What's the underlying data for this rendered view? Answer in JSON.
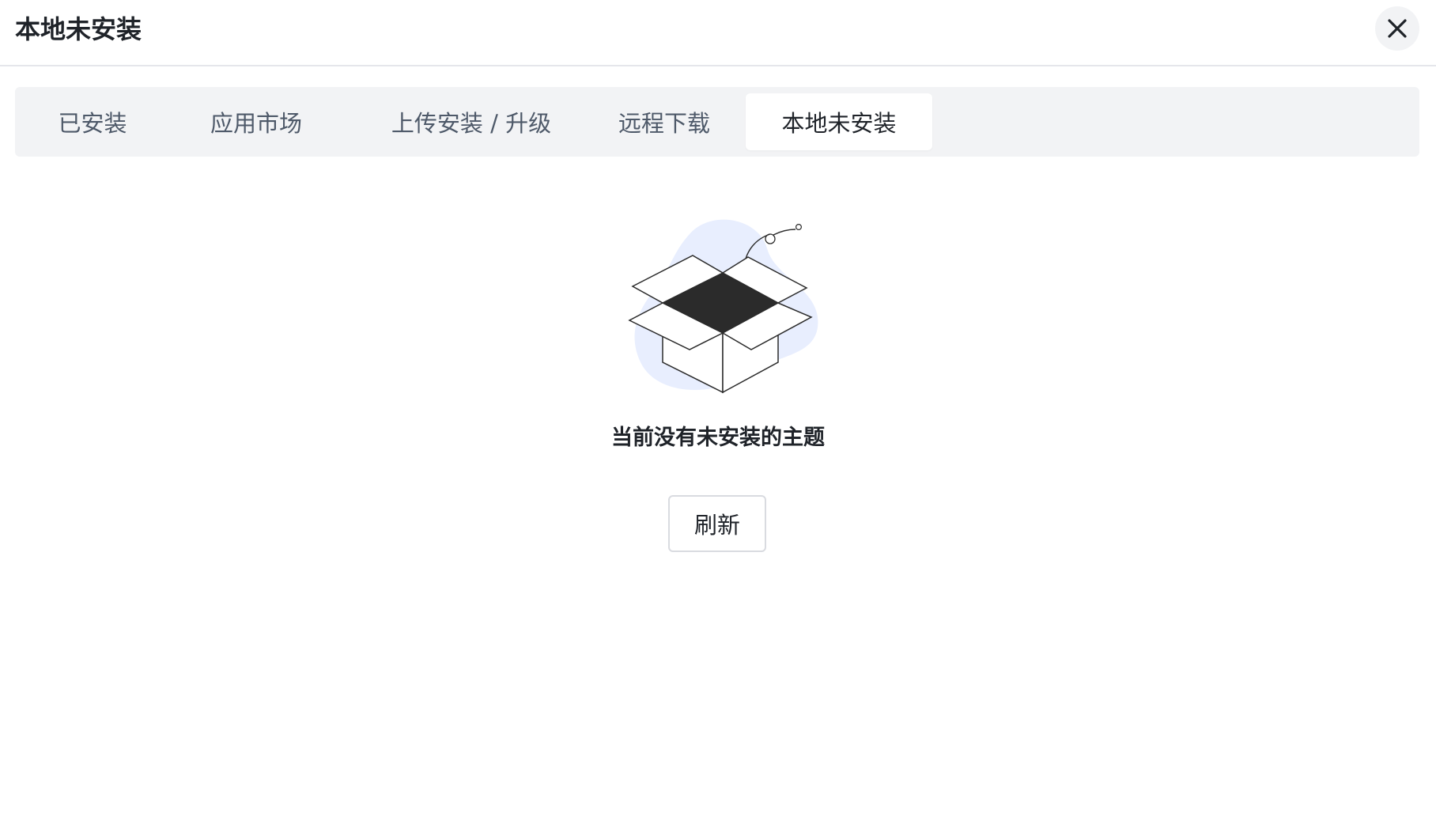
{
  "dialog": {
    "title": "本地未安装",
    "close_icon": "close-icon"
  },
  "tabs": [
    {
      "label": "已安装",
      "active": false
    },
    {
      "label": "应用市场",
      "active": false
    },
    {
      "label": "上传安装 / 升级",
      "active": false
    },
    {
      "label": "远程下载",
      "active": false
    },
    {
      "label": "本地未安装",
      "active": true
    }
  ],
  "empty_state": {
    "icon": "open-box-icon",
    "message": "当前没有未安装的主题",
    "refresh_label": "刷新"
  },
  "colors": {
    "tab_bar_bg": "#f2f3f5",
    "blob": "#e8eefe",
    "text_primary": "#1f2329",
    "text_secondary": "#4e5969"
  }
}
